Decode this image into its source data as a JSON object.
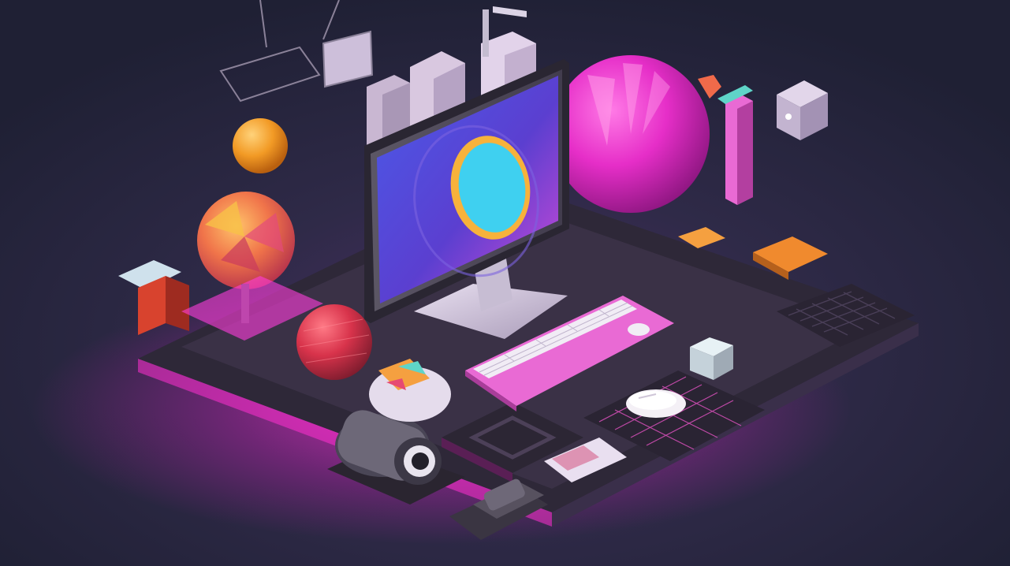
{
  "scene": {
    "subject": "isometric-tech-workspace",
    "palette": {
      "background": "#24243a",
      "background_glow": "#3a2f52",
      "base_dark": "#2b2536",
      "base_mid": "#3c3248",
      "neon_magenta": "#ff2fd0",
      "pink": "#e96ad4",
      "hot_pink": "#ff3ddc",
      "screen_blue": "#3b4fd6",
      "screen_cyan": "#3fd0f0",
      "ring_orange": "#f7b23b",
      "orange": "#f59a2e",
      "red": "#d33a52",
      "lavender": "#d8c9df",
      "keyboard_white": "#f1ecf5",
      "teal": "#5fd4c8"
    },
    "objects": [
      "monitor",
      "monitor-screen",
      "keyboard",
      "mouse",
      "camera-lens",
      "magenta-sphere",
      "orange-sphere",
      "polygon-sphere",
      "red-sphere",
      "floating-cube",
      "tower-buildings",
      "game-controller"
    ]
  }
}
